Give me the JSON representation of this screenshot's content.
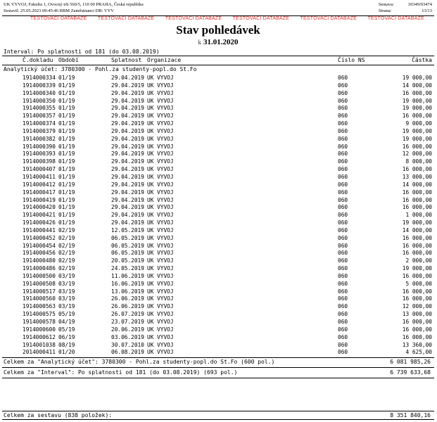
{
  "header": {
    "org_line": "UK VYVOJ, Fakulta 1, Ovocný trh 560/5, 110 00 PRAHA, Česká republika",
    "printed_line": "Sestavil: 25.05.2023 09:45:46 BBM Zaměstnanci  DB: VYV",
    "report_label": "Sestava:",
    "report_value": "10349/03474",
    "page_label": "Strana:",
    "page_value": "13/13"
  },
  "banner": [
    "TESTOVACÍ DATABÁZE",
    "TESTOVACÍ DATABÁZE",
    "TESTOVACÍ DATABÁZE",
    "TESTOVACÍ DATABÁZE",
    "TESTOVACÍ DATABÁZE",
    "TESTOVACÍ DATABÁZE"
  ],
  "title": "Stav pohledávek",
  "subtitle_prefix": "k",
  "subtitle_date": "31.01.2020",
  "interval": "Interval: Po splatnosti od 181 (do 03.08.2019)",
  "columns": {
    "doc": "Č.dokladu",
    "period": "Období",
    "due": "Splatnost",
    "org": "Organizace",
    "ns": "Číslo NS",
    "amount": "Částka"
  },
  "analytic_account": "Analytický účet: 3780300 - Pohl.za studenty-popl.do St.Fo",
  "rows": [
    [
      "1914000334",
      "01/19",
      "29.04.2019",
      "UK VYVOJ",
      "060",
      "19 000,00"
    ],
    [
      "1914000339",
      "01/19",
      "29.04.2019",
      "UK VYVOJ",
      "060",
      "14 000,00"
    ],
    [
      "1914000340",
      "01/19",
      "29.04.2019",
      "UK VYVOJ",
      "060",
      "16 000,00"
    ],
    [
      "1914000350",
      "01/19",
      "29.04.2019",
      "UK VYVOJ",
      "060",
      "19 000,00"
    ],
    [
      "1914000355",
      "01/19",
      "29.04.2019",
      "UK VYVOJ",
      "060",
      "19 000,00"
    ],
    [
      "1914000357",
      "01/19",
      "29.04.2019",
      "UK VYVOJ",
      "060",
      "16 000,00"
    ],
    [
      "1914000374",
      "01/19",
      "29.04.2019",
      "UK VYVOJ",
      "060",
      "9 000,00"
    ],
    [
      "1914000379",
      "01/19",
      "29.04.2019",
      "UK VYVOJ",
      "060",
      "19 000,00"
    ],
    [
      "1914000382",
      "01/19",
      "29.04.2019",
      "UK VYVOJ",
      "060",
      "19 000,00"
    ],
    [
      "1914000390",
      "01/19",
      "29.04.2019",
      "UK VYVOJ",
      "060",
      "16 000,00"
    ],
    [
      "1914000393",
      "01/19",
      "29.04.2019",
      "UK VYVOJ",
      "060",
      "12 000,00"
    ],
    [
      "1914000398",
      "01/19",
      "29.04.2019",
      "UK VYVOJ",
      "060",
      "8 000,00"
    ],
    [
      "1914000407",
      "01/19",
      "29.04.2019",
      "UK VYVOJ",
      "060",
      "16 000,00"
    ],
    [
      "1914000411",
      "01/19",
      "29.04.2019",
      "UK VYVOJ",
      "060",
      "13 000,00"
    ],
    [
      "1914000412",
      "01/19",
      "29.04.2019",
      "UK VYVOJ",
      "060",
      "14 000,00"
    ],
    [
      "1914000417",
      "01/19",
      "29.04.2019",
      "UK VYVOJ",
      "060",
      "16 000,00"
    ],
    [
      "1914000419",
      "01/19",
      "29.04.2019",
      "UK VYVOJ",
      "060",
      "16 000,00"
    ],
    [
      "1914000420",
      "01/19",
      "29.04.2019",
      "UK VYVOJ",
      "060",
      "16 000,00"
    ],
    [
      "1914000421",
      "01/19",
      "29.04.2019",
      "UK VYVOJ",
      "060",
      "1 000,00"
    ],
    [
      "1914000426",
      "01/19",
      "29.04.2019",
      "UK VYVOJ",
      "060",
      "19 000,00"
    ],
    [
      "1914000441",
      "02/19",
      "12.05.2019",
      "UK VYVOJ",
      "060",
      "14 000,00"
    ],
    [
      "1914000452",
      "02/19",
      "06.05.2019",
      "UK VYVOJ",
      "060",
      "16 000,00"
    ],
    [
      "1914000454",
      "02/19",
      "06.05.2019",
      "UK VYVOJ",
      "060",
      "16 000,00"
    ],
    [
      "1914000456",
      "02/19",
      "06.05.2019",
      "UK VYVOJ",
      "060",
      "16 000,00"
    ],
    [
      "1914000480",
      "02/19",
      "20.05.2019",
      "UK VYVOJ",
      "060",
      "2 000,00"
    ],
    [
      "1914000486",
      "02/19",
      "24.05.2019",
      "UK VYVOJ",
      "060",
      "19 000,00"
    ],
    [
      "1914000500",
      "03/19",
      "11.06.2019",
      "UK VYVOJ",
      "060",
      "16 000,00"
    ],
    [
      "1914000508",
      "03/19",
      "16.06.2019",
      "UK VYVOJ",
      "060",
      "5 000,00"
    ],
    [
      "1914000517",
      "03/19",
      "13.06.2019",
      "UK VYVOJ",
      "060",
      "16 000,00"
    ],
    [
      "1914000560",
      "03/19",
      "26.06.2019",
      "UK VYVOJ",
      "060",
      "16 000,00"
    ],
    [
      "1914000563",
      "03/19",
      "26.06.2019",
      "UK VYVOJ",
      "060",
      "12 000,00"
    ],
    [
      "1914000575",
      "05/19",
      "26.07.2019",
      "UK VYVOJ",
      "060",
      "13 000,00"
    ],
    [
      "1914000578",
      "04/19",
      "23.07.2019",
      "UK VYVOJ",
      "060",
      "16 000,00"
    ],
    [
      "1914000600",
      "05/19",
      "20.06.2019",
      "UK VYVOJ",
      "060",
      "16 000,00"
    ],
    [
      "1914000612",
      "06/19",
      "03.06.2019",
      "UK VYVOJ",
      "060",
      "16 000,00"
    ],
    [
      "1914001038",
      "08/19",
      "30.07.2010",
      "UK VYVOJ",
      "060",
      "13 360,00"
    ],
    [
      "2014000411",
      "01/20",
      "06.08.2019",
      "UK VYVOJ",
      "060",
      "4 625,00"
    ]
  ],
  "totals": {
    "analytic_label": "Celkem za \"Analytický účet\": 3780300 - Pohl.za studenty-popl.do St.Fo (600 pol.)",
    "analytic_amount": "6 081 985,26",
    "interval_label": "Celkem za \"Interval\": Po splatnosti od 181 (do 03.08.2019) (693 pol.)",
    "interval_amount": "6 739 633,68",
    "report_label": "Celkem za sestavu (838 položek):",
    "report_amount": "8 351 840,16"
  }
}
